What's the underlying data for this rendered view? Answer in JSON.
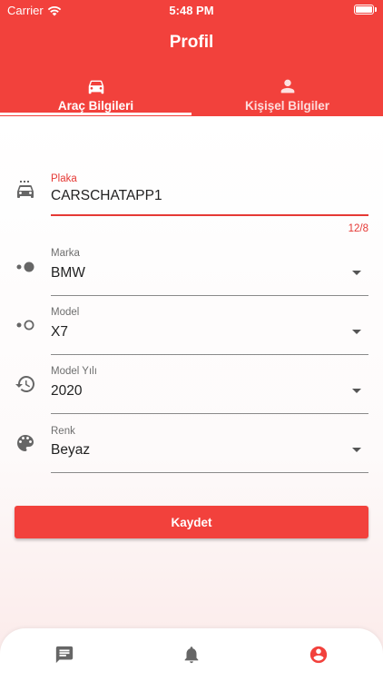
{
  "status_bar": {
    "carrier": "Carrier",
    "time": "5:48 PM"
  },
  "header": {
    "title": "Profil"
  },
  "tabs": [
    {
      "label": "Araç Bilgileri",
      "icon": "car-icon",
      "active": true
    },
    {
      "label": "Kişişel Bilgiler",
      "icon": "person-icon",
      "active": false
    }
  ],
  "form": {
    "plaka": {
      "label": "Plaka",
      "value": "CARSCHATAPP1",
      "counter": "12/8",
      "icon": "car-side-icon"
    },
    "marka": {
      "label": "Marka",
      "value": "BMW",
      "icon": "toggle-dots-icon"
    },
    "model": {
      "label": "Model",
      "value": "X7",
      "icon": "toggle-dots-outline-icon"
    },
    "model_yili": {
      "label": "Model Yılı",
      "value": "2020",
      "icon": "history-icon"
    },
    "renk": {
      "label": "Renk",
      "value": "Beyaz",
      "icon": "palette-icon"
    }
  },
  "save_label": "Kaydet",
  "bottom_nav": [
    {
      "icon": "chat-icon"
    },
    {
      "icon": "bell-icon"
    },
    {
      "icon": "account-circle-icon"
    }
  ],
  "colors": {
    "primary": "#f2413c",
    "error": "#e53935"
  }
}
